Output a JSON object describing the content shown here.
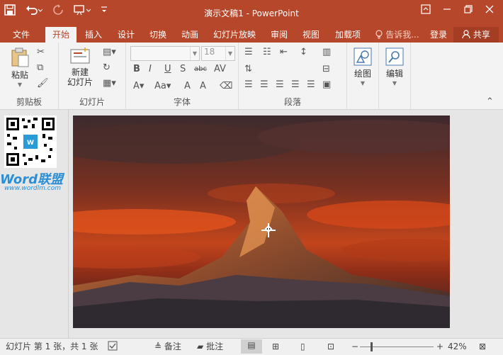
{
  "window": {
    "title": "演示文稿1 - PowerPoint",
    "qat": {
      "save_icon": "save-icon",
      "undo_icon": "undo-icon",
      "redo_icon": "redo-icon",
      "present_icon": "present-icon",
      "customize_icon": "customize-icon"
    },
    "buttons": {
      "ribbon_display": "ribbon-display-icon",
      "minimize": "minimize-icon",
      "restore": "restore-icon",
      "close": "close-icon"
    }
  },
  "tabs": [
    {
      "label": "文件"
    },
    {
      "label": "开始",
      "active": true
    },
    {
      "label": "插入"
    },
    {
      "label": "设计"
    },
    {
      "label": "切换"
    },
    {
      "label": "动画"
    },
    {
      "label": "幻灯片放映"
    },
    {
      "label": "审阅"
    },
    {
      "label": "视图"
    },
    {
      "label": "加载项"
    }
  ],
  "tellme": {
    "label": "告诉我..."
  },
  "account": {
    "signin": "登录",
    "share": "共享"
  },
  "ribbon": {
    "clipboard": {
      "paste": "粘贴",
      "label": "剪贴板"
    },
    "slides": {
      "new_slide_line1": "新建",
      "new_slide_line2": "幻灯片",
      "label": "幻灯片"
    },
    "font": {
      "font_name": "",
      "font_size": "18",
      "label": "字体"
    },
    "paragraph": {
      "label": "段落"
    },
    "drawing": {
      "label": "绘图"
    },
    "editing": {
      "label": "编辑"
    }
  },
  "watermark": {
    "brand": "Word联盟",
    "url": "www.wordlm.com"
  },
  "status": {
    "slide_info": "幻灯片 第 1 张，共 1 张",
    "notes": "备注",
    "comments": "批注",
    "zoom": "42%"
  },
  "colors": {
    "accent": "#b7472a",
    "ribbon_bg": "#f3f3f3"
  }
}
